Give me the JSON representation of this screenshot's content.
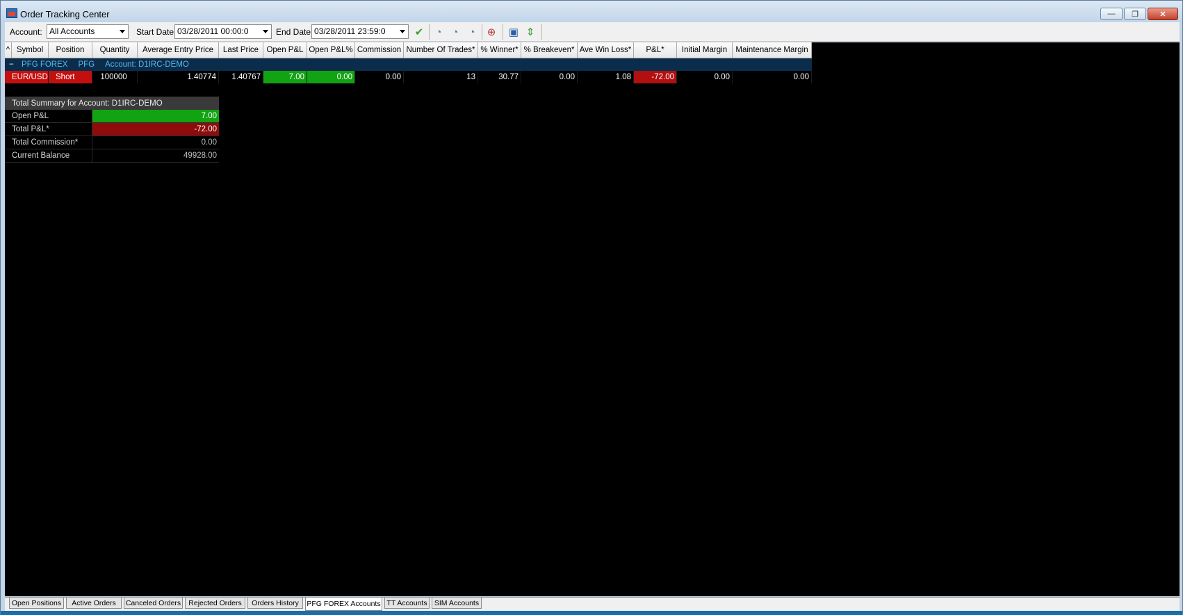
{
  "window": {
    "title": "Order Tracking Center",
    "buttons": {
      "minimize": "—",
      "restore": "❐",
      "close": "✕"
    }
  },
  "toolbar": {
    "account_label": "Account:",
    "account_value": "All Accounts",
    "start_label": "Start Date:",
    "start_value": "03/28/2011 00:00:0",
    "end_label": "End Date:",
    "end_value": "03/28/2011 23:59:0",
    "icons": [
      "apply-check-icon",
      "day-filter-icon",
      "week-filter-icon",
      "year-filter-icon",
      "clock-icon",
      "save-icon",
      "settings-icon"
    ]
  },
  "grid": {
    "sort_indicator": "^",
    "columns": [
      "Symbol",
      "Position",
      "Quantity",
      "Average Entry Price",
      "Last Price",
      "Open P&L",
      "Open P&L%",
      "Commission",
      "Number Of Trades*",
      "% Winner*",
      "% Breakeven*",
      "Ave Win Loss*",
      "P&L*",
      "Initial Margin",
      "Maintenance Margin"
    ],
    "group": {
      "toggle": "−",
      "broker": "PFG FOREX",
      "code": "PFG",
      "account": "Account: D1IRC-DEMO"
    },
    "rows": [
      {
        "symbol": "EUR/USD",
        "position": "Short",
        "quantity": "100000",
        "avg_entry": "1.40774",
        "last_price": "1.40767",
        "open_pnl": "7.00",
        "open_pnl_pct": "0.00",
        "commission": "0.00",
        "num_trades": "13",
        "pct_winner": "30.77",
        "pct_breakeven": "0.00",
        "ave_win_loss": "1.08",
        "pnl": "-72.00",
        "initial_margin": "0.00",
        "maintenance_margin": "0.00"
      }
    ]
  },
  "summary": {
    "title": "Total Summary for Account: D1IRC-DEMO",
    "rows": [
      {
        "label": "Open P&L",
        "value": "7.00"
      },
      {
        "label": "Total P&L*",
        "value": "-72.00"
      },
      {
        "label": "Total Commission*",
        "value": "0.00"
      },
      {
        "label": "Current Balance",
        "value": "49928.00"
      }
    ]
  },
  "tabs": [
    "Open Positions",
    "Active Orders",
    "Canceled Orders",
    "Rejected Orders",
    "Orders History",
    "PFG FOREX Accounts",
    "TT Accounts",
    "SIM Accounts"
  ],
  "active_tab": "PFG FOREX Accounts",
  "colors": {
    "gain": "#12a312",
    "loss": "#b20f0f",
    "symbol_bg": "#c40f0f",
    "group_bg": "#0b2d4b"
  }
}
